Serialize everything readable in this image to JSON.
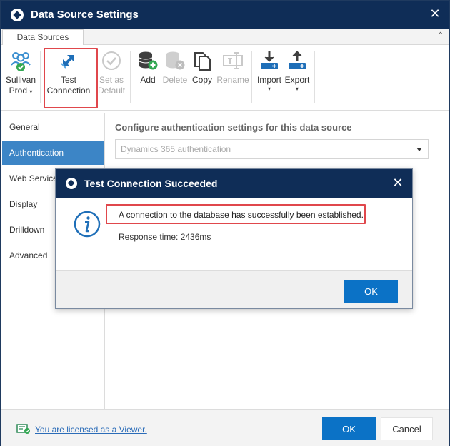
{
  "window": {
    "title": "Data Source Settings",
    "close_glyph": "✕"
  },
  "tabs": [
    {
      "label": "Data Sources"
    }
  ],
  "collapse_glyph": "⌃",
  "ribbon": {
    "sullivan": {
      "line1": "Sullivan",
      "line2": "Prod",
      "arrow": "▾",
      "icon": "users-group-icon"
    },
    "test": {
      "line1": "Test",
      "line2": "Connection",
      "icon": "test-connection-icon"
    },
    "setdefault": {
      "line1": "Set as",
      "line2": "Default",
      "icon": "check-circle-icon"
    },
    "add": {
      "label": "Add",
      "icon": "database-add-icon"
    },
    "delete": {
      "label": "Delete",
      "icon": "database-delete-icon"
    },
    "copy": {
      "label": "Copy",
      "icon": "copy-icon"
    },
    "rename": {
      "label": "Rename",
      "icon": "rename-icon"
    },
    "import": {
      "label": "Import",
      "arrow": "▾",
      "icon": "import-icon"
    },
    "export": {
      "label": "Export",
      "arrow": "▾",
      "icon": "export-icon"
    }
  },
  "sidebar": {
    "items": [
      {
        "label": "General"
      },
      {
        "label": "Authentication"
      },
      {
        "label": "Web Service"
      },
      {
        "label": "Display"
      },
      {
        "label": "Drilldown"
      },
      {
        "label": "Advanced"
      }
    ]
  },
  "content": {
    "heading": "Configure authentication settings for this data source",
    "auth_select_value": "Dynamics 365 authentication"
  },
  "dialog": {
    "title": "Test Connection Succeeded",
    "close_glyph": "✕",
    "message": "A connection to the database has successfully been established.",
    "response": "Response time: 2436ms",
    "ok_label": "OK"
  },
  "footer": {
    "license_text": "You are licensed as a Viewer.",
    "ok_label": "OK",
    "cancel_label": "Cancel"
  },
  "colors": {
    "titlebar": "#0f2d57",
    "active_nav": "#3c85c6",
    "primary_button": "#0b72c6",
    "highlight": "#e0474c"
  }
}
